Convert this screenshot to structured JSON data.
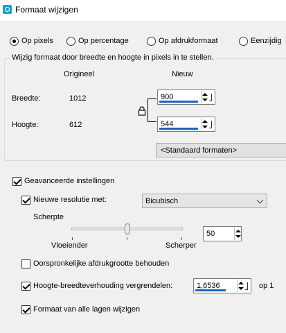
{
  "window": {
    "title": "Formaat wijzigen"
  },
  "mode_options": [
    {
      "label": "Op pixels",
      "selected": true
    },
    {
      "label": "Op percentage",
      "selected": false
    },
    {
      "label": "Op afdrukformaat",
      "selected": false
    },
    {
      "label": "Eenzijdig",
      "selected": false
    }
  ],
  "pixel_group": {
    "title": "Wijzig formaat door breedte en hoogte in pixels in te stellen.",
    "col_original": "Origineel",
    "col_new": "Nieuw",
    "width_label": "Breedte:",
    "width_original": "1012",
    "width_new": "900",
    "height_label": "Hoogte:",
    "height_original": "612",
    "height_new": "544",
    "standard_formats": "<Standaard formaten>"
  },
  "advanced": {
    "label": "Geavanceerde instellingen",
    "checked": true,
    "resample_label": "Nieuwe resolutie met:",
    "resample_checked": true,
    "resample_method": "Bicubisch",
    "sharpness_label": "Scherpte",
    "sharpness_value": "50",
    "sharpness_level": 0.5,
    "slider_min_label": "Vloeiender",
    "slider_max_label": "Scherper",
    "keep_print_size_label": "Oorspronkelijke afdrukgrootte behouden",
    "keep_print_size_checked": false,
    "lock_aspect_label": "Hoogte-breedteverhouding vergrendelen:",
    "lock_aspect_checked": true,
    "aspect_value": "1,6536",
    "aspect_suffix": "op 1",
    "all_layers_label": "Formaat van alle lagen wijzigen",
    "all_layers_checked": true
  },
  "colors": {
    "accent": "#1466c2",
    "app_icon": "#1aa3c7"
  }
}
